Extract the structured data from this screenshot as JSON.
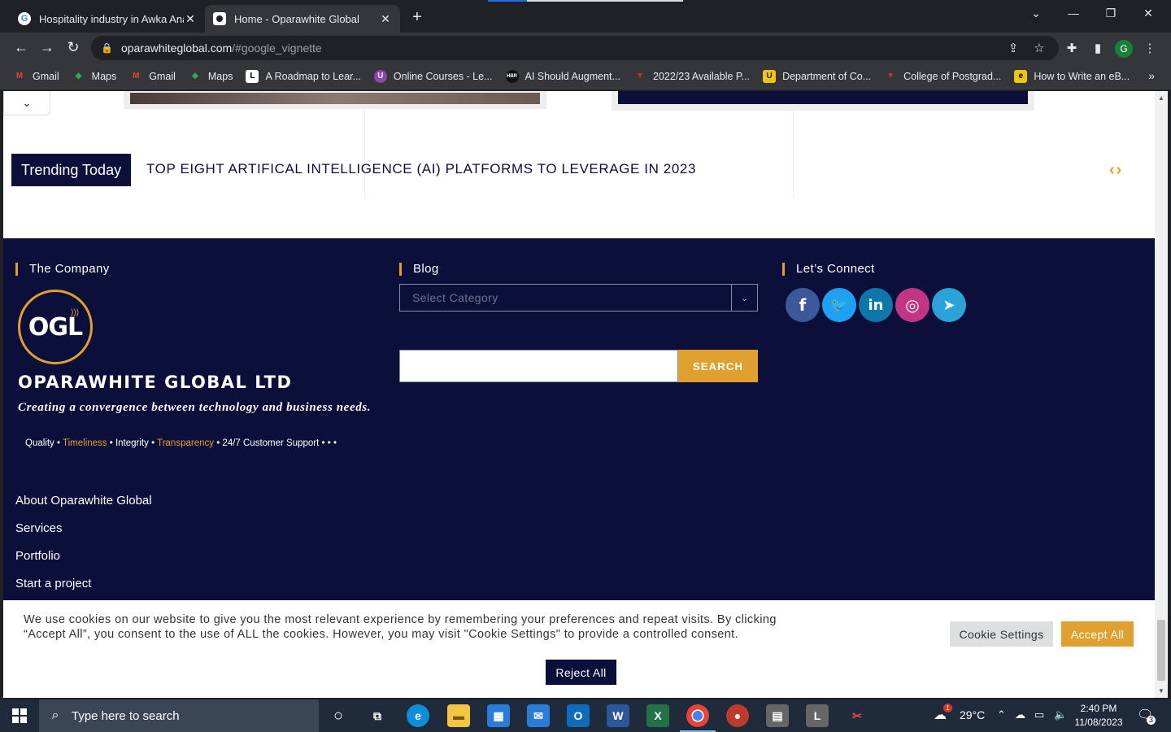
{
  "browser": {
    "tabs": [
      {
        "title": "Hospitality industry in Awka Anam",
        "favicon_color": "#ffffff",
        "active": false
      },
      {
        "title": "Home - Oparawhite Global",
        "favicon_color": "#ffffff",
        "active": true
      }
    ],
    "url_host": "oparawhiteglobal.com",
    "url_path": "/#google_vignette",
    "profile_initial": "G",
    "bookmarks": [
      {
        "label": "Gmail",
        "icon": "gmail-icon",
        "color": "#ea4335",
        "glyph": "M"
      },
      {
        "label": "Maps",
        "icon": "maps-icon",
        "color": "#34a853",
        "glyph": "◆"
      },
      {
        "label": "Gmail",
        "icon": "gmail-icon",
        "color": "#ea4335",
        "glyph": "M"
      },
      {
        "label": "Maps",
        "icon": "maps-icon",
        "color": "#34a853",
        "glyph": "◆"
      },
      {
        "label": "A Roadmap to Lear...",
        "icon": "roadmap-icon",
        "color": "#ffffff",
        "glyph": "L"
      },
      {
        "label": "Online Courses - Le...",
        "icon": "courses-icon",
        "color": "#8e44ad",
        "glyph": "U"
      },
      {
        "label": "AI Should Augment...",
        "icon": "hbr-icon",
        "color": "#111111",
        "glyph": "HBR"
      },
      {
        "label": "2022/23 Available P...",
        "icon": "shield-icon",
        "color": "#c0392b",
        "glyph": "▼"
      },
      {
        "label": "Department of Co...",
        "icon": "university-icon",
        "color": "#f1c40f",
        "glyph": "U"
      },
      {
        "label": "College of Postgrad...",
        "icon": "shield-icon",
        "color": "#c0392b",
        "glyph": "▼"
      },
      {
        "label": "How to Write an eB...",
        "icon": "ebook-icon",
        "color": "#f1c40f",
        "glyph": "e"
      }
    ],
    "bookmarks_more": "»"
  },
  "page": {
    "trending_label": "Trending Today",
    "trending_headline": "TOP EIGHT ARTIFICAL INTELLIGENCE (AI) PLATFORMS TO LEVERAGE IN 2023",
    "trending_arrows": "‹›",
    "footer": {
      "company": {
        "heading": "The Company",
        "logo_text": "OGL",
        "name": "OPARAWHITE GLOBAL LTD",
        "tagline": "Creating a convergence between technology and business needs.",
        "values": [
          {
            "text": "Quality",
            "gold": false
          },
          {
            "text": "Timeliness",
            "gold": true
          },
          {
            "text": "Integrity",
            "gold": false
          },
          {
            "text": "Transparency",
            "gold": true
          },
          {
            "text": "24/7 Customer Support",
            "gold": false
          }
        ],
        "values_trail": "• • •",
        "links": [
          "About Oparawhite Global",
          "Services",
          "Portfolio",
          "Start a project"
        ]
      },
      "blog": {
        "heading": "Blog",
        "select_placeholder": "Select Category",
        "search_button": "SEARCH"
      },
      "connect": {
        "heading": "Let’s Connect",
        "socials": [
          {
            "name": "facebook",
            "glyph": "f",
            "color": "#3b5998"
          },
          {
            "name": "twitter",
            "glyph": "🐦",
            "color": "#1da1f2"
          },
          {
            "name": "linkedin",
            "glyph": "in",
            "color": "#0e76a8"
          },
          {
            "name": "instagram",
            "glyph": "◎",
            "color": "#c13584"
          },
          {
            "name": "telegram",
            "glyph": "➤",
            "color": "#2aa3d9"
          }
        ]
      }
    },
    "cookie": {
      "text": "We use cookies on our website to give you the most relevant experience by remembering your preferences and repeat visits. By clicking “Accept All”, you consent to the use of ALL the cookies. However, you may visit \"Cookie Settings\" to provide a controlled consent.",
      "settings_label": "Cookie Settings",
      "accept_label": "Accept All",
      "reject_label": "Reject All"
    },
    "colors": {
      "navy": "#0b0f3a",
      "gold": "#e0a030"
    }
  },
  "taskbar": {
    "search_placeholder": "Type here to search",
    "weather": "29°C",
    "weather_badge": "1",
    "time": "2:40 PM",
    "date": "11/08/2023",
    "notifications": "3"
  }
}
